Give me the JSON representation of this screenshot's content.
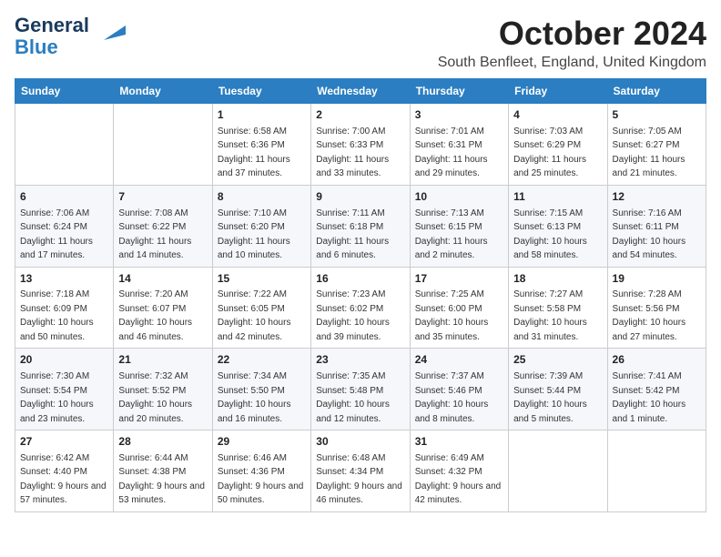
{
  "header": {
    "logo_line1": "General",
    "logo_line2": "Blue",
    "month": "October 2024",
    "location": "South Benfleet, England, United Kingdom"
  },
  "days_of_week": [
    "Sunday",
    "Monday",
    "Tuesday",
    "Wednesday",
    "Thursday",
    "Friday",
    "Saturday"
  ],
  "weeks": [
    [
      {
        "day": "",
        "info": ""
      },
      {
        "day": "",
        "info": ""
      },
      {
        "day": "1",
        "info": "Sunrise: 6:58 AM\nSunset: 6:36 PM\nDaylight: 11 hours and 37 minutes."
      },
      {
        "day": "2",
        "info": "Sunrise: 7:00 AM\nSunset: 6:33 PM\nDaylight: 11 hours and 33 minutes."
      },
      {
        "day": "3",
        "info": "Sunrise: 7:01 AM\nSunset: 6:31 PM\nDaylight: 11 hours and 29 minutes."
      },
      {
        "day": "4",
        "info": "Sunrise: 7:03 AM\nSunset: 6:29 PM\nDaylight: 11 hours and 25 minutes."
      },
      {
        "day": "5",
        "info": "Sunrise: 7:05 AM\nSunset: 6:27 PM\nDaylight: 11 hours and 21 minutes."
      }
    ],
    [
      {
        "day": "6",
        "info": "Sunrise: 7:06 AM\nSunset: 6:24 PM\nDaylight: 11 hours and 17 minutes."
      },
      {
        "day": "7",
        "info": "Sunrise: 7:08 AM\nSunset: 6:22 PM\nDaylight: 11 hours and 14 minutes."
      },
      {
        "day": "8",
        "info": "Sunrise: 7:10 AM\nSunset: 6:20 PM\nDaylight: 11 hours and 10 minutes."
      },
      {
        "day": "9",
        "info": "Sunrise: 7:11 AM\nSunset: 6:18 PM\nDaylight: 11 hours and 6 minutes."
      },
      {
        "day": "10",
        "info": "Sunrise: 7:13 AM\nSunset: 6:15 PM\nDaylight: 11 hours and 2 minutes."
      },
      {
        "day": "11",
        "info": "Sunrise: 7:15 AM\nSunset: 6:13 PM\nDaylight: 10 hours and 58 minutes."
      },
      {
        "day": "12",
        "info": "Sunrise: 7:16 AM\nSunset: 6:11 PM\nDaylight: 10 hours and 54 minutes."
      }
    ],
    [
      {
        "day": "13",
        "info": "Sunrise: 7:18 AM\nSunset: 6:09 PM\nDaylight: 10 hours and 50 minutes."
      },
      {
        "day": "14",
        "info": "Sunrise: 7:20 AM\nSunset: 6:07 PM\nDaylight: 10 hours and 46 minutes."
      },
      {
        "day": "15",
        "info": "Sunrise: 7:22 AM\nSunset: 6:05 PM\nDaylight: 10 hours and 42 minutes."
      },
      {
        "day": "16",
        "info": "Sunrise: 7:23 AM\nSunset: 6:02 PM\nDaylight: 10 hours and 39 minutes."
      },
      {
        "day": "17",
        "info": "Sunrise: 7:25 AM\nSunset: 6:00 PM\nDaylight: 10 hours and 35 minutes."
      },
      {
        "day": "18",
        "info": "Sunrise: 7:27 AM\nSunset: 5:58 PM\nDaylight: 10 hours and 31 minutes."
      },
      {
        "day": "19",
        "info": "Sunrise: 7:28 AM\nSunset: 5:56 PM\nDaylight: 10 hours and 27 minutes."
      }
    ],
    [
      {
        "day": "20",
        "info": "Sunrise: 7:30 AM\nSunset: 5:54 PM\nDaylight: 10 hours and 23 minutes."
      },
      {
        "day": "21",
        "info": "Sunrise: 7:32 AM\nSunset: 5:52 PM\nDaylight: 10 hours and 20 minutes."
      },
      {
        "day": "22",
        "info": "Sunrise: 7:34 AM\nSunset: 5:50 PM\nDaylight: 10 hours and 16 minutes."
      },
      {
        "day": "23",
        "info": "Sunrise: 7:35 AM\nSunset: 5:48 PM\nDaylight: 10 hours and 12 minutes."
      },
      {
        "day": "24",
        "info": "Sunrise: 7:37 AM\nSunset: 5:46 PM\nDaylight: 10 hours and 8 minutes."
      },
      {
        "day": "25",
        "info": "Sunrise: 7:39 AM\nSunset: 5:44 PM\nDaylight: 10 hours and 5 minutes."
      },
      {
        "day": "26",
        "info": "Sunrise: 7:41 AM\nSunset: 5:42 PM\nDaylight: 10 hours and 1 minute."
      }
    ],
    [
      {
        "day": "27",
        "info": "Sunrise: 6:42 AM\nSunset: 4:40 PM\nDaylight: 9 hours and 57 minutes."
      },
      {
        "day": "28",
        "info": "Sunrise: 6:44 AM\nSunset: 4:38 PM\nDaylight: 9 hours and 53 minutes."
      },
      {
        "day": "29",
        "info": "Sunrise: 6:46 AM\nSunset: 4:36 PM\nDaylight: 9 hours and 50 minutes."
      },
      {
        "day": "30",
        "info": "Sunrise: 6:48 AM\nSunset: 4:34 PM\nDaylight: 9 hours and 46 minutes."
      },
      {
        "day": "31",
        "info": "Sunrise: 6:49 AM\nSunset: 4:32 PM\nDaylight: 9 hours and 42 minutes."
      },
      {
        "day": "",
        "info": ""
      },
      {
        "day": "",
        "info": ""
      }
    ]
  ]
}
